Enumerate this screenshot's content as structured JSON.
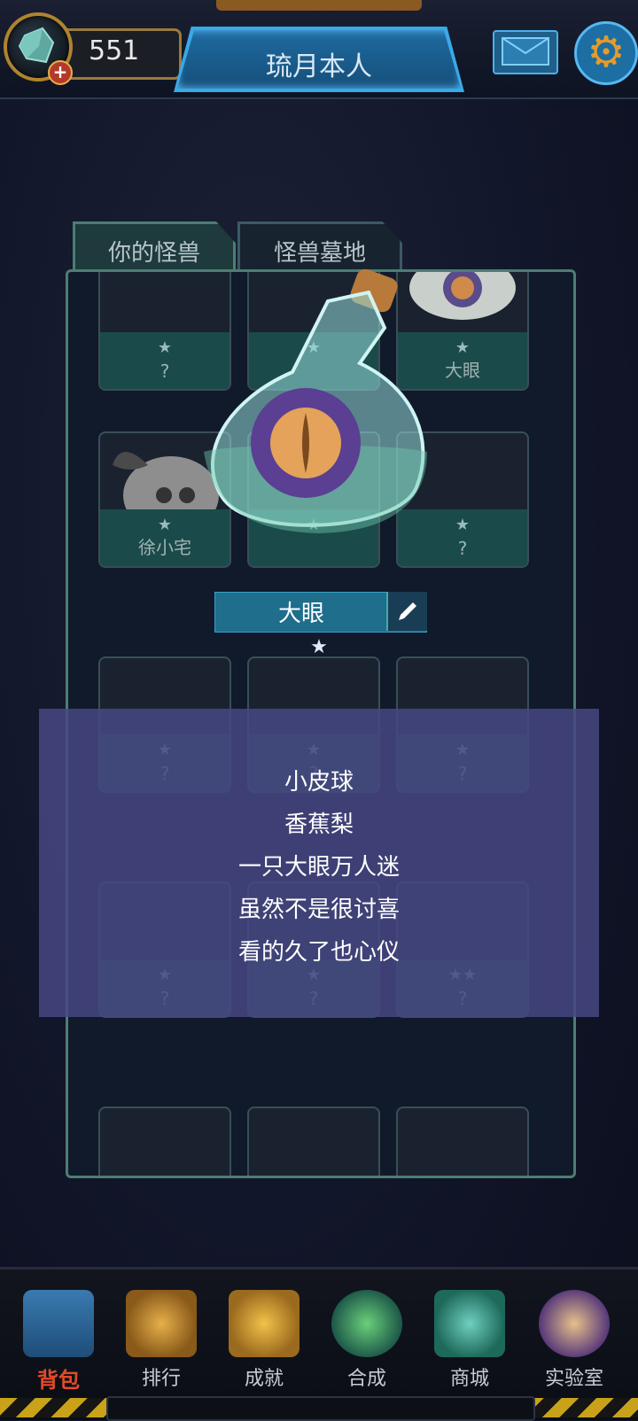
{
  "header": {
    "currency_value": "551",
    "player_name": "琉月本人",
    "gem_icon": "gem-icon",
    "mail_icon": "mail-icon",
    "settings_icon": "gear-icon"
  },
  "tabs": [
    {
      "label": "你的怪兽",
      "active": true
    },
    {
      "label": "怪兽墓地",
      "active": false
    }
  ],
  "monster_cards": [
    {
      "stars": "★",
      "name": "?"
    },
    {
      "stars": "★",
      "name": ""
    },
    {
      "stars": "★",
      "name": "大眼"
    },
    {
      "stars": "★",
      "name": "徐小宅"
    },
    {
      "stars": "★",
      "name": ""
    },
    {
      "stars": "★",
      "name": "?"
    },
    {
      "stars": "★",
      "name": "?"
    },
    {
      "stars": "★",
      "name": "?"
    },
    {
      "stars": "★",
      "name": "?"
    },
    {
      "stars": "★",
      "name": "?"
    },
    {
      "stars": "★",
      "name": "?"
    },
    {
      "stars": "★★",
      "name": "?"
    }
  ],
  "selected_monster": {
    "name": "大眼",
    "rarity_stars": "★",
    "description": [
      "小皮球",
      "香蕉梨",
      "一只大眼万人迷",
      "虽然不是很讨喜",
      "看的久了也心仪"
    ]
  },
  "bottom_nav": [
    {
      "label": "背包",
      "icon": "backpack-icon",
      "active": true
    },
    {
      "label": "排行",
      "icon": "trophy-icon",
      "active": false
    },
    {
      "label": "成就",
      "icon": "crown-icon",
      "active": false
    },
    {
      "label": "合成",
      "icon": "flask-icon",
      "active": false
    },
    {
      "label": "商城",
      "icon": "shop-gem-icon",
      "active": false
    },
    {
      "label": "实验室",
      "icon": "egg-icon",
      "active": false
    }
  ],
  "colors": {
    "panel_border": "#4c7e72",
    "accent_blue": "#1e6aa0",
    "active_nav": "#e24a2a"
  }
}
